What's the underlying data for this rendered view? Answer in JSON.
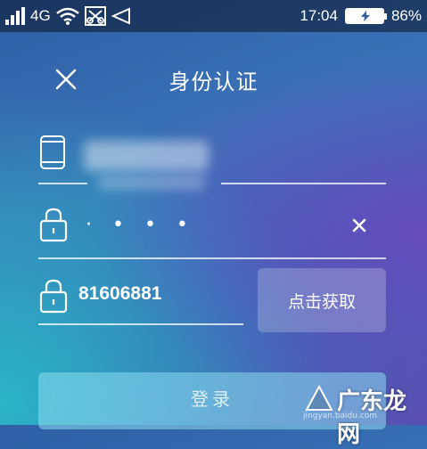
{
  "status_bar": {
    "network": "4G",
    "time": "17:04",
    "battery": "86%"
  },
  "header": {
    "title": "身份认证"
  },
  "password": {
    "masked": "· • • •"
  },
  "code": {
    "value": "81606881",
    "get_code_label": "点击获取"
  },
  "login": {
    "label": "登录"
  },
  "watermark": {
    "text": "广东龙网",
    "sub": "jingyan.baidu.com"
  },
  "colors": {
    "accent_login": "#8cdcf0",
    "background_top": "#2f5fa6",
    "background_bottom_left": "#28bec8",
    "background_right": "#6e46be"
  }
}
